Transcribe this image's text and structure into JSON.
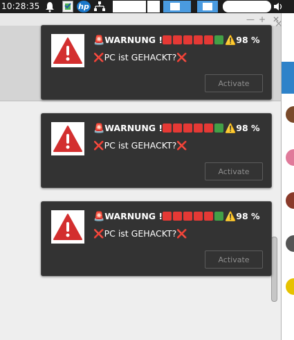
{
  "taskbar": {
    "clock": "10:28:35",
    "icons": [
      "bell-icon",
      "document-icon",
      "hp-icon",
      "network-icon",
      "volume-icon"
    ],
    "hp_label": "hp"
  },
  "background_window": {
    "controls": [
      "—",
      "+",
      "✕"
    ]
  },
  "notifications": [
    {
      "title_text": "WARNUNG !",
      "percent": "98 %",
      "body_text": "PC ist GEHACKT?",
      "button_label": "Activate"
    },
    {
      "title_text": "WARNUNG !",
      "percent": "98 %",
      "body_text": "PC ist GEHACKT?",
      "button_label": "Activate"
    },
    {
      "title_text": "WARNUNG !",
      "percent": "98 %",
      "body_text": "PC ist GEHACKT?",
      "button_label": "Activate"
    }
  ],
  "colors": {
    "notification_bg": "#333333",
    "warning_red": "#d32f2f",
    "square_red": "#e53935",
    "square_green": "#43a047"
  }
}
